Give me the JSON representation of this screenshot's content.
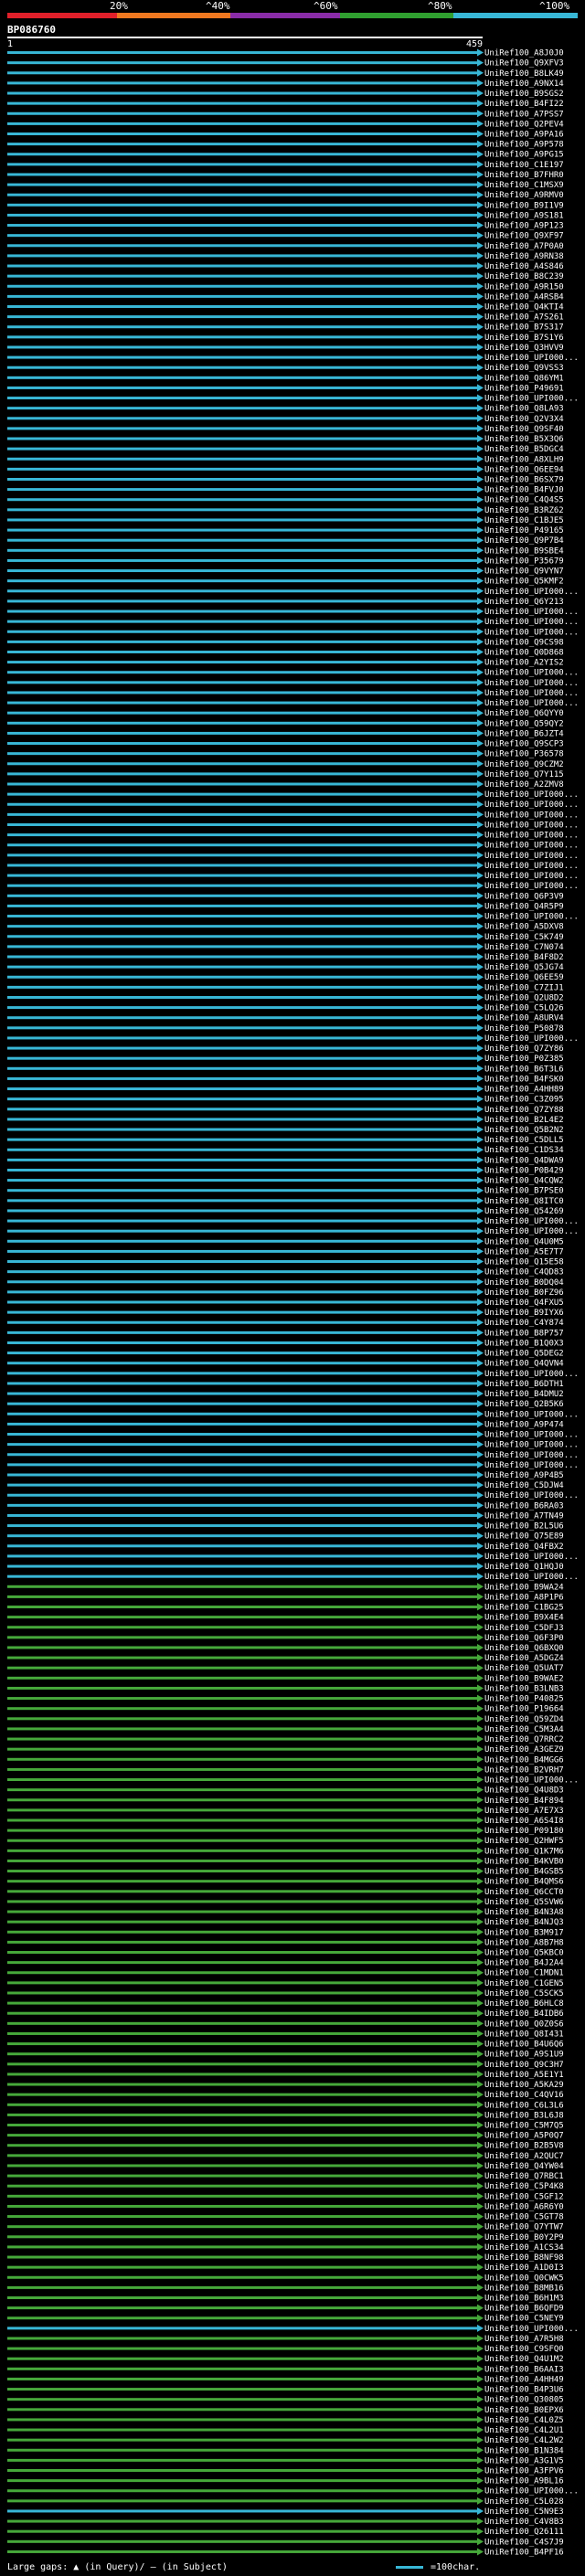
{
  "legend": {
    "labels": [
      "20%",
      "^40%",
      "^60%",
      "^80%",
      "^100%"
    ],
    "colors": [
      "#e0202a",
      "#f07820",
      "#8a2ca8",
      "#30a030",
      "#38b7d6"
    ]
  },
  "query_name": "BP086760",
  "scale": {
    "start": "1",
    "end": "459"
  },
  "hit_colors": {
    "blue": "#38b7d6",
    "green": "#46a83a",
    "dark": "#102808"
  },
  "chart_data": {
    "type": "alignment-map",
    "query_length": 459,
    "hits": [
      {
        "id": "UniRef100_A8J0J0",
        "c": "b"
      },
      {
        "id": "UniRef100_Q9XFV3",
        "c": "b"
      },
      {
        "id": "UniRef100_B8LK49",
        "c": "b"
      },
      {
        "id": "UniRef100_A9NX14",
        "c": "b"
      },
      {
        "id": "UniRef100_B9SGS2",
        "c": "b"
      },
      {
        "id": "UniRef100_B4FI22",
        "c": "b"
      },
      {
        "id": "UniRef100_A7PSS7",
        "c": "b"
      },
      {
        "id": "UniRef100_Q2PEV4",
        "c": "b"
      },
      {
        "id": "UniRef100_A9PA16",
        "c": "b"
      },
      {
        "id": "UniRef100_A9P578",
        "c": "b"
      },
      {
        "id": "UniRef100_A9PG15",
        "c": "b"
      },
      {
        "id": "UniRef100_C1E197",
        "c": "b"
      },
      {
        "id": "UniRef100_B7FHR0",
        "c": "b"
      },
      {
        "id": "UniRef100_C1MSX9",
        "c": "b"
      },
      {
        "id": "UniRef100_A9RMV0",
        "c": "b"
      },
      {
        "id": "UniRef100_B9I1V9",
        "c": "b"
      },
      {
        "id": "UniRef100_A9S181",
        "c": "b"
      },
      {
        "id": "UniRef100_A9P123",
        "c": "b"
      },
      {
        "id": "UniRef100_Q9XF97",
        "c": "b"
      },
      {
        "id": "UniRef100_A7P0A0",
        "c": "b"
      },
      {
        "id": "UniRef100_A9RN38",
        "c": "b"
      },
      {
        "id": "UniRef100_A4S846",
        "c": "b"
      },
      {
        "id": "UniRef100_B8C239",
        "c": "b"
      },
      {
        "id": "UniRef100_A9R150",
        "c": "b"
      },
      {
        "id": "UniRef100_A4RSB4",
        "c": "b"
      },
      {
        "id": "UniRef100_Q4KTI4",
        "c": "b"
      },
      {
        "id": "UniRef100_A7S261",
        "c": "b"
      },
      {
        "id": "UniRef100_B7S317",
        "c": "b"
      },
      {
        "id": "UniRef100_B7S1Y6",
        "c": "b"
      },
      {
        "id": "UniRef100_Q3HVV9",
        "c": "b"
      },
      {
        "id": "UniRef100_UPI000...",
        "c": "b"
      },
      {
        "id": "UniRef100_Q9VSS3",
        "c": "b"
      },
      {
        "id": "UniRef100_Q86YM1",
        "c": "b"
      },
      {
        "id": "UniRef100_P49691",
        "c": "b"
      },
      {
        "id": "UniRef100_UPI000...",
        "c": "b"
      },
      {
        "id": "UniRef100_Q8LA93",
        "c": "b"
      },
      {
        "id": "UniRef100_Q2V3X4",
        "c": "b"
      },
      {
        "id": "UniRef100_Q9SF40",
        "c": "b"
      },
      {
        "id": "UniRef100_B5X3Q6",
        "c": "b"
      },
      {
        "id": "UniRef100_B5DGC4",
        "c": "b"
      },
      {
        "id": "UniRef100_A8XLH9",
        "c": "b"
      },
      {
        "id": "UniRef100_Q6EE94",
        "c": "b"
      },
      {
        "id": "UniRef100_B6SX79",
        "c": "b"
      },
      {
        "id": "UniRef100_B4FVJ0",
        "c": "b"
      },
      {
        "id": "UniRef100_C4Q4S5",
        "c": "b"
      },
      {
        "id": "UniRef100_B3RZ62",
        "c": "b"
      },
      {
        "id": "UniRef100_C1BJE5",
        "c": "b"
      },
      {
        "id": "UniRef100_P49165",
        "c": "b"
      },
      {
        "id": "UniRef100_Q9P7B4",
        "c": "b"
      },
      {
        "id": "UniRef100_B9SBE4",
        "c": "b"
      },
      {
        "id": "UniRef100_P35679",
        "c": "b"
      },
      {
        "id": "UniRef100_Q9VYN7",
        "c": "b"
      },
      {
        "id": "UniRef100_Q5KMF2",
        "c": "b"
      },
      {
        "id": "UniRef100_UPI000...",
        "c": "b"
      },
      {
        "id": "UniRef100_Q6Y213",
        "c": "b"
      },
      {
        "id": "UniRef100_UPI000...",
        "c": "b"
      },
      {
        "id": "UniRef100_UPI000...",
        "c": "b"
      },
      {
        "id": "UniRef100_UPI000...",
        "c": "b"
      },
      {
        "id": "UniRef100_Q9CS98",
        "c": "b"
      },
      {
        "id": "UniRef100_Q0D868",
        "c": "b"
      },
      {
        "id": "UniRef100_A2YIS2",
        "c": "b"
      },
      {
        "id": "UniRef100_UPI000...",
        "c": "b"
      },
      {
        "id": "UniRef100_UPI000...",
        "c": "b"
      },
      {
        "id": "UniRef100_UPI000...",
        "c": "b"
      },
      {
        "id": "UniRef100_UPI000...",
        "c": "b"
      },
      {
        "id": "UniRef100_Q6QYY0",
        "c": "b"
      },
      {
        "id": "UniRef100_Q59QY2",
        "c": "b"
      },
      {
        "id": "UniRef100_B6JZT4",
        "c": "b"
      },
      {
        "id": "UniRef100_Q9SCP3",
        "c": "b"
      },
      {
        "id": "UniRef100_P36578",
        "c": "b"
      },
      {
        "id": "UniRef100_Q9CZM2",
        "c": "b"
      },
      {
        "id": "UniRef100_Q7Y115",
        "c": "b"
      },
      {
        "id": "UniRef100_A2ZMV8",
        "c": "b"
      },
      {
        "id": "UniRef100_UPI000...",
        "c": "b"
      },
      {
        "id": "UniRef100_UPI000...",
        "c": "b"
      },
      {
        "id": "UniRef100_UPI000...",
        "c": "b"
      },
      {
        "id": "UniRef100_UPI000...",
        "c": "b"
      },
      {
        "id": "UniRef100_UPI000...",
        "c": "b"
      },
      {
        "id": "UniRef100_UPI000...",
        "c": "b"
      },
      {
        "id": "UniRef100_UPI000...",
        "c": "b"
      },
      {
        "id": "UniRef100_UPI000...",
        "c": "b"
      },
      {
        "id": "UniRef100_UPI000...",
        "c": "b"
      },
      {
        "id": "UniRef100_UPI000...",
        "c": "b"
      },
      {
        "id": "UniRef100_Q6P3V9",
        "c": "b"
      },
      {
        "id": "UniRef100_Q4R5P9",
        "c": "b"
      },
      {
        "id": "UniRef100_UPI000...",
        "c": "b"
      },
      {
        "id": "UniRef100_A5DXV8",
        "c": "b"
      },
      {
        "id": "UniRef100_C5K749",
        "c": "b"
      },
      {
        "id": "UniRef100_C7N074",
        "c": "b"
      },
      {
        "id": "UniRef100_B4F8D2",
        "c": "b"
      },
      {
        "id": "UniRef100_Q5JG74",
        "c": "b"
      },
      {
        "id": "UniRef100_Q6EE59",
        "c": "b"
      },
      {
        "id": "UniRef100_C7ZIJ1",
        "c": "b"
      },
      {
        "id": "UniRef100_Q2U8D2",
        "c": "b"
      },
      {
        "id": "UniRef100_C5LQ26",
        "c": "b"
      },
      {
        "id": "UniRef100_A8URV4",
        "c": "b"
      },
      {
        "id": "UniRef100_P50878",
        "c": "b"
      },
      {
        "id": "UniRef100_UPI000...",
        "c": "b"
      },
      {
        "id": "UniRef100_Q7ZY86",
        "c": "b"
      },
      {
        "id": "UniRef100_P0Z385",
        "c": "b"
      },
      {
        "id": "UniRef100_B6T3L6",
        "c": "b"
      },
      {
        "id": "UniRef100_B4FSK0",
        "c": "b"
      },
      {
        "id": "UniRef100_A4HH89",
        "c": "b"
      },
      {
        "id": "UniRef100_C3Z095",
        "c": "b"
      },
      {
        "id": "UniRef100_Q7ZY88",
        "c": "b"
      },
      {
        "id": "UniRef100_B2L4E2",
        "c": "b"
      },
      {
        "id": "UniRef100_Q5B2N2",
        "c": "b"
      },
      {
        "id": "UniRef100_C5DLL5",
        "c": "b"
      },
      {
        "id": "UniRef100_C1DS34",
        "c": "b"
      },
      {
        "id": "UniRef100_Q4DWA9",
        "c": "b"
      },
      {
        "id": "UniRef100_P0B429",
        "c": "b"
      },
      {
        "id": "UniRef100_Q4CQW2",
        "c": "b"
      },
      {
        "id": "UniRef100_B7PSE0",
        "c": "b"
      },
      {
        "id": "UniRef100_Q8ITC0",
        "c": "b"
      },
      {
        "id": "UniRef100_Q54269",
        "c": "b"
      },
      {
        "id": "UniRef100_UPI000...",
        "c": "b"
      },
      {
        "id": "UniRef100_UPI000...",
        "c": "b"
      },
      {
        "id": "UniRef100_Q4U0M5",
        "c": "b"
      },
      {
        "id": "UniRef100_A5E7T7",
        "c": "b"
      },
      {
        "id": "UniRef100_Q15E58",
        "c": "b"
      },
      {
        "id": "UniRef100_C4QD83",
        "c": "b"
      },
      {
        "id": "UniRef100_B0DQ04",
        "c": "b"
      },
      {
        "id": "UniRef100_B0FZ96",
        "c": "b"
      },
      {
        "id": "UniRef100_Q4FXU5",
        "c": "b"
      },
      {
        "id": "UniRef100_B9IYX6",
        "c": "b"
      },
      {
        "id": "UniRef100_C4Y874",
        "c": "b"
      },
      {
        "id": "UniRef100_B8P757",
        "c": "b"
      },
      {
        "id": "UniRef100_B1Q0X3",
        "c": "b"
      },
      {
        "id": "UniRef100_Q5DEG2",
        "c": "b"
      },
      {
        "id": "UniRef100_Q4QVN4",
        "c": "b"
      },
      {
        "id": "UniRef100_UPI000...",
        "c": "b"
      },
      {
        "id": "UniRef100_B6DTH1",
        "c": "b"
      },
      {
        "id": "UniRef100_B4DMU2",
        "c": "b"
      },
      {
        "id": "UniRef100_Q2B5K6",
        "c": "b"
      },
      {
        "id": "UniRef100_UPI000...",
        "c": "b"
      },
      {
        "id": "UniRef100_A9P474",
        "c": "b"
      },
      {
        "id": "UniRef100_UPI000...",
        "c": "b"
      },
      {
        "id": "UniRef100_UPI000...",
        "c": "b"
      },
      {
        "id": "UniRef100_UPI000...",
        "c": "b"
      },
      {
        "id": "UniRef100_UPI000...",
        "c": "b"
      },
      {
        "id": "UniRef100_A9P4B5",
        "c": "b"
      },
      {
        "id": "UniRef100_C5DJW4",
        "c": "b"
      },
      {
        "id": "UniRef100_UPI000...",
        "c": "b"
      },
      {
        "id": "UniRef100_B6RA03",
        "c": "b"
      },
      {
        "id": "UniRef100_A7TN49",
        "c": "b"
      },
      {
        "id": "UniRef100_B2L5U6",
        "c": "b"
      },
      {
        "id": "UniRef100_Q75E89",
        "c": "b"
      },
      {
        "id": "UniRef100_Q4FBX2",
        "c": "b"
      },
      {
        "id": "UniRef100_UPI000...",
        "c": "b"
      },
      {
        "id": "UniRef100_Q1HQJ0",
        "c": "b"
      },
      {
        "id": "UniRef100_UPI000...",
        "c": "b"
      },
      {
        "id": "UniRef100_B9WA24",
        "c": "g"
      },
      {
        "id": "UniRef100_A8P1P6",
        "c": "g"
      },
      {
        "id": "UniRef100_C1BG25",
        "c": "g"
      },
      {
        "id": "UniRef100_B9X4E4",
        "c": "g"
      },
      {
        "id": "UniRef100_C5DFJ3",
        "c": "g"
      },
      {
        "id": "UniRef100_Q6F3P0",
        "c": "g"
      },
      {
        "id": "UniRef100_Q6BXQ0",
        "c": "g"
      },
      {
        "id": "UniRef100_A5DGZ4",
        "c": "g"
      },
      {
        "id": "UniRef100_Q5UAT7",
        "c": "g"
      },
      {
        "id": "UniRef100_B9WAE2",
        "c": "g"
      },
      {
        "id": "UniRef100_B3LNB3",
        "c": "g"
      },
      {
        "id": "UniRef100_P40825",
        "c": "g"
      },
      {
        "id": "UniRef100_P19664",
        "c": "g"
      },
      {
        "id": "UniRef100_Q59ZD4",
        "c": "g"
      },
      {
        "id": "UniRef100_C5M3A4",
        "c": "g"
      },
      {
        "id": "UniRef100_Q7RRC2",
        "c": "g"
      },
      {
        "id": "UniRef100_A3GEZ9",
        "c": "g"
      },
      {
        "id": "UniRef100_B4MGG6",
        "c": "g"
      },
      {
        "id": "UniRef100_B2VRH7",
        "c": "g"
      },
      {
        "id": "UniRef100_UPI000...",
        "c": "g"
      },
      {
        "id": "UniRef100_Q4U8D3",
        "c": "g"
      },
      {
        "id": "UniRef100_B4F894",
        "c": "g"
      },
      {
        "id": "UniRef100_A7E7X3",
        "c": "g"
      },
      {
        "id": "UniRef100_A6S4I8",
        "c": "g"
      },
      {
        "id": "UniRef100_P09180",
        "c": "g"
      },
      {
        "id": "UniRef100_Q2HWF5",
        "c": "g"
      },
      {
        "id": "UniRef100_Q1K7M6",
        "c": "g"
      },
      {
        "id": "UniRef100_B4KVB0",
        "c": "g"
      },
      {
        "id": "UniRef100_B4GSB5",
        "c": "g"
      },
      {
        "id": "UniRef100_B4QMS6",
        "c": "g"
      },
      {
        "id": "UniRef100_Q6CCT0",
        "c": "g"
      },
      {
        "id": "UniRef100_Q5SVW6",
        "c": "g"
      },
      {
        "id": "UniRef100_B4N3A8",
        "c": "g"
      },
      {
        "id": "UniRef100_B4NJQ3",
        "c": "g"
      },
      {
        "id": "UniRef100_B3M917",
        "c": "g"
      },
      {
        "id": "UniRef100_A8B7H8",
        "c": "g"
      },
      {
        "id": "UniRef100_Q5KBC0",
        "c": "g"
      },
      {
        "id": "UniRef100_B4J2A4",
        "c": "g"
      },
      {
        "id": "UniRef100_C1MDN1",
        "c": "g"
      },
      {
        "id": "UniRef100_C1GEN5",
        "c": "g"
      },
      {
        "id": "UniRef100_C5SCK5",
        "c": "g"
      },
      {
        "id": "UniRef100_B6HLC8",
        "c": "g"
      },
      {
        "id": "UniRef100_B4IDB6",
        "c": "g"
      },
      {
        "id": "UniRef100_Q0Z0S6",
        "c": "g"
      },
      {
        "id": "UniRef100_Q8I431",
        "c": "g"
      },
      {
        "id": "UniRef100_B4U6Q6",
        "c": "g"
      },
      {
        "id": "UniRef100_A9S1U9",
        "c": "g"
      },
      {
        "id": "UniRef100_Q9C3H7",
        "c": "g"
      },
      {
        "id": "UniRef100_A5E1Y1",
        "c": "g"
      },
      {
        "id": "UniRef100_A5KA29",
        "c": "g"
      },
      {
        "id": "UniRef100_C4QV16",
        "c": "g"
      },
      {
        "id": "UniRef100_C6L3L6",
        "c": "g"
      },
      {
        "id": "UniRef100_B3L6J8",
        "c": "g"
      },
      {
        "id": "UniRef100_C5M7Q5",
        "c": "g"
      },
      {
        "id": "UniRef100_A5P0Q7",
        "c": "g"
      },
      {
        "id": "UniRef100_B2B5V8",
        "c": "g"
      },
      {
        "id": "UniRef100_A2QUC7",
        "c": "g"
      },
      {
        "id": "UniRef100_Q4YW04",
        "c": "g"
      },
      {
        "id": "UniRef100_Q7RBC1",
        "c": "g"
      },
      {
        "id": "UniRef100_C5P4K8",
        "c": "g"
      },
      {
        "id": "UniRef100_C5GF12",
        "c": "g"
      },
      {
        "id": "UniRef100_A6R6Y0",
        "c": "g"
      },
      {
        "id": "UniRef100_C5GT78",
        "c": "g"
      },
      {
        "id": "UniRef100_Q7YTW7",
        "c": "g"
      },
      {
        "id": "UniRef100_B0Y2P9",
        "c": "g"
      },
      {
        "id": "UniRef100_A1CS34",
        "c": "g"
      },
      {
        "id": "UniRef100_B8NF98",
        "c": "g"
      },
      {
        "id": "UniRef100_A1D0I3",
        "c": "g"
      },
      {
        "id": "UniRef100_Q0CWK5",
        "c": "g"
      },
      {
        "id": "UniRef100_B8MB16",
        "c": "g"
      },
      {
        "id": "UniRef100_B6H1M3",
        "c": "g"
      },
      {
        "id": "UniRef100_B6QFD9",
        "c": "g"
      },
      {
        "id": "UniRef100_C5NEY9",
        "c": "g"
      },
      {
        "id": "UniRef100_UPI000...",
        "c": "b"
      },
      {
        "id": "UniRef100_A7R5H8",
        "c": "g"
      },
      {
        "id": "UniRef100_C9SFQ0",
        "c": "g"
      },
      {
        "id": "UniRef100_Q4U1M2",
        "c": "g"
      },
      {
        "id": "UniRef100_B6AAI3",
        "c": "g"
      },
      {
        "id": "UniRef100_A4HH49",
        "c": "g"
      },
      {
        "id": "UniRef100_B4P3U6",
        "c": "g"
      },
      {
        "id": "UniRef100_Q30805",
        "c": "g"
      },
      {
        "id": "UniRef100_B0EPX6",
        "c": "g"
      },
      {
        "id": "UniRef100_C4L0Z5",
        "c": "g"
      },
      {
        "id": "UniRef100_C4L2U1",
        "c": "g"
      },
      {
        "id": "UniRef100_C4L2W2",
        "c": "g"
      },
      {
        "id": "UniRef100_B1N384",
        "c": "g"
      },
      {
        "id": "UniRef100_A3G1V5",
        "c": "g"
      },
      {
        "id": "UniRef100_A3FPV6",
        "c": "g"
      },
      {
        "id": "UniRef100_A9BL16",
        "c": "g"
      },
      {
        "id": "UniRef100_UPI000...",
        "c": "g"
      },
      {
        "id": "UniRef100_C5L028",
        "c": "g"
      },
      {
        "id": "UniRef100_C5N9E3",
        "c": "b"
      },
      {
        "id": "UniRef100_C4V8B3",
        "c": "g"
      },
      {
        "id": "UniRef100_Q26111",
        "c": "g"
      },
      {
        "id": "UniRef100_C4S7J9",
        "c": "g"
      },
      {
        "id": "UniRef100_B4PF16",
        "c": "g"
      }
    ]
  },
  "footer": {
    "large_gaps_label": "Large gaps:",
    "in_query": "(in Query)/",
    "in_subject": "(in Subject)",
    "scale_note": "=100char."
  }
}
